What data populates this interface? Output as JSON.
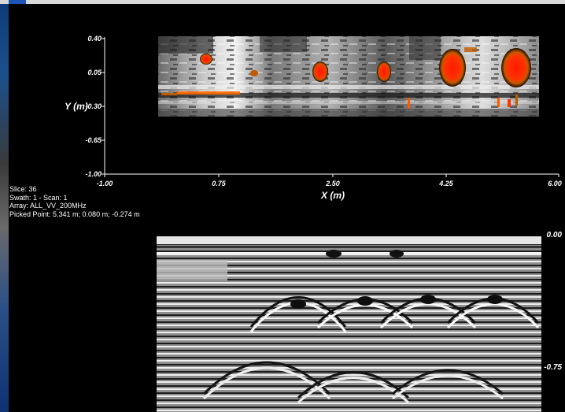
{
  "plan_view": {
    "y_axis": {
      "title": "Y (m)",
      "ticks": [
        "0.40",
        "0.05",
        "-0.30",
        "-0.65",
        "-1.00"
      ]
    },
    "x_axis": {
      "title": "X (m)",
      "ticks": [
        "-1.00",
        "0.75",
        "2.50",
        "4.25",
        "6.00"
      ]
    },
    "colors": {
      "background": "#000000",
      "hot": "#ff2a00",
      "warm": "#ff8c00",
      "grey": "#9a9a9a"
    }
  },
  "info": {
    "slice": "Slice:  36",
    "swath": "Swath: 1 - Scan: 1",
    "array": "Array: ALL_VV_200MHz",
    "picked_point": "Picked Point:  5.341 m; 0.080 m; -0.274 m"
  },
  "radargram": {
    "depth_ticks": [
      "0.00",
      "-0.75"
    ]
  }
}
